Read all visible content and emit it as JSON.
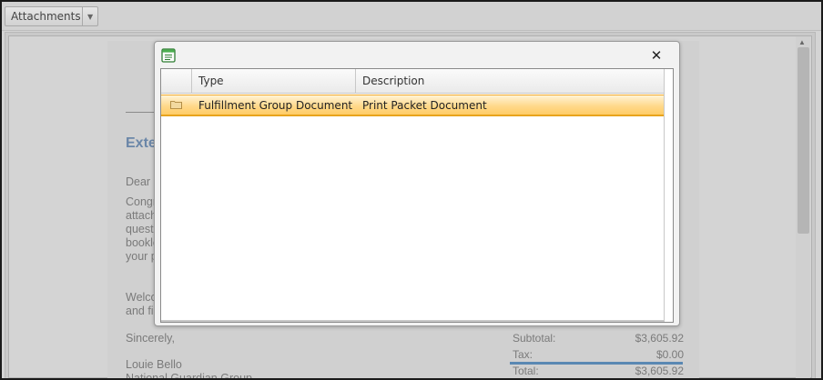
{
  "toolbar": {
    "attachments_label": "Attachments"
  },
  "document": {
    "heading_partial": "Exte",
    "greeting_partial": "Dear I",
    "para1": [
      "Congr",
      "attach",
      "questi",
      "bookle",
      "your p"
    ],
    "para2": [
      "Welco",
      "and fi"
    ],
    "closing": "Sincerely,",
    "signer_name": "Louie Bello",
    "signer_org_partial": "National Guardian Group",
    "totals": [
      {
        "label": "Subtotal:",
        "value": "$3,605.92"
      },
      {
        "label": "Tax:",
        "value": "$0.00"
      },
      {
        "label": "Total:",
        "value": "$3,605.92"
      }
    ]
  },
  "modal": {
    "icon": "document-list-icon",
    "close_icon": "close-icon",
    "columns": [
      "Type",
      "Description"
    ],
    "rows": [
      {
        "icon": "folder-icon",
        "type": "Fulfillment Group Document",
        "description": "Print Packet Document"
      }
    ]
  },
  "colors": {
    "selected_row": "#ffd98c",
    "heading": "#6a86a8",
    "totals_rule": "#5a88b3"
  }
}
